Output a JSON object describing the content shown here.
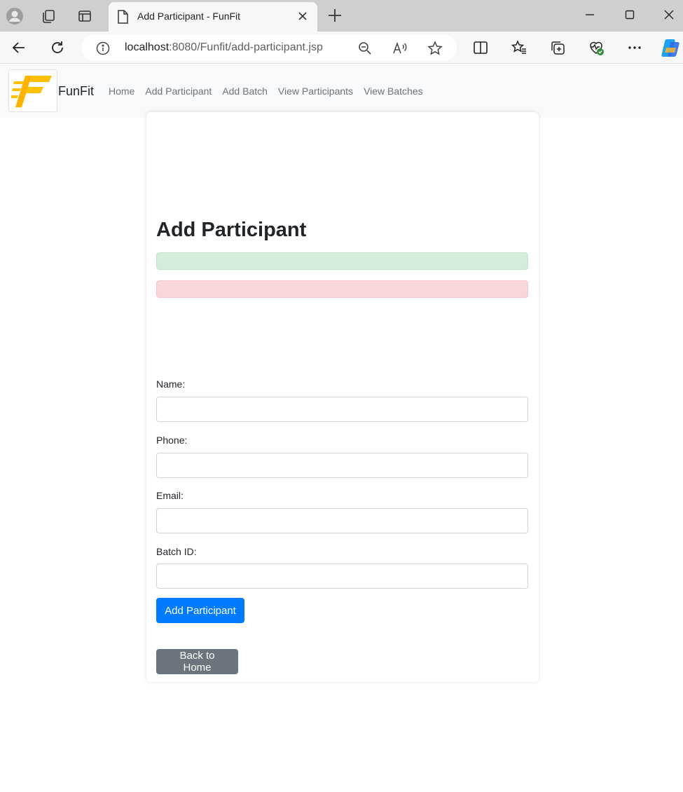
{
  "browser": {
    "tab_title": "Add Participant - FunFit",
    "url_host": "localhost",
    "url_rest": ":8080/Funfit/add-participant.jsp"
  },
  "site": {
    "brand": "FunFit",
    "brand_color": "#ffc107",
    "nav": [
      {
        "label": "Home"
      },
      {
        "label": "Add Participant"
      },
      {
        "label": "Add Batch"
      },
      {
        "label": "View Participants"
      },
      {
        "label": "View Batches"
      }
    ]
  },
  "page": {
    "title": "Add Participant",
    "success_message": "",
    "error_message": ""
  },
  "form": {
    "name_label": "Name:",
    "name_value": "",
    "phone_label": "Phone:",
    "phone_value": "",
    "email_label": "Email:",
    "email_value": "",
    "batch_label": "Batch ID:",
    "batch_value": "",
    "submit_label": "Add Participant",
    "back_label": "Back to Home"
  },
  "colors": {
    "primary": "#007bff",
    "secondary": "#6c757d",
    "success_bg": "#d4edda",
    "danger_bg": "#f8d7da"
  }
}
